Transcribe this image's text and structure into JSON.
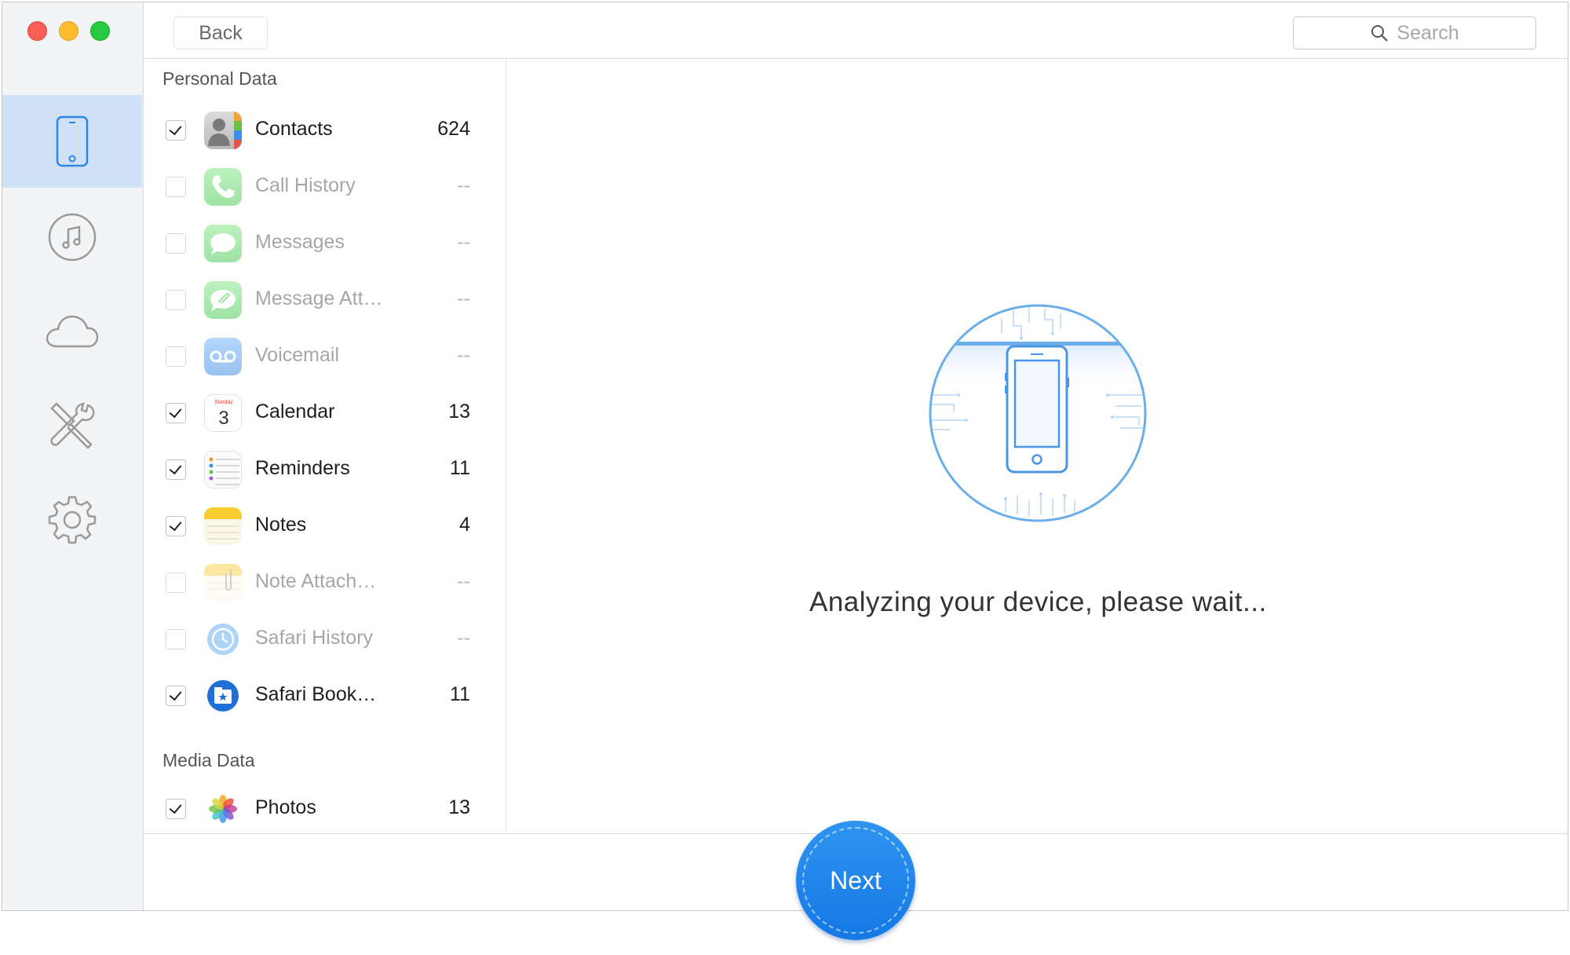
{
  "window": {
    "traffic_lights": [
      "close",
      "minimize",
      "maximize"
    ]
  },
  "rail": {
    "items": [
      {
        "icon": "phone-icon",
        "active": true
      },
      {
        "icon": "music-icon",
        "active": false
      },
      {
        "icon": "cloud-icon",
        "active": false
      },
      {
        "icon": "tools-icon",
        "active": false
      },
      {
        "icon": "gear-icon",
        "active": false
      }
    ]
  },
  "toolbar": {
    "back_label": "Back",
    "search_placeholder": "Search"
  },
  "personal": {
    "title": "Personal Data",
    "items": [
      {
        "label": "Contacts",
        "count": "624",
        "checked": true,
        "enabled": true,
        "icon": "contacts-icon"
      },
      {
        "label": "Call History",
        "count": "--",
        "checked": false,
        "enabled": false,
        "icon": "phone-call-icon"
      },
      {
        "label": "Messages",
        "count": "--",
        "checked": false,
        "enabled": false,
        "icon": "messages-icon"
      },
      {
        "label": "Message Att…",
        "count": "--",
        "checked": false,
        "enabled": false,
        "icon": "message-attachment-icon"
      },
      {
        "label": "Voicemail",
        "count": "--",
        "checked": false,
        "enabled": false,
        "icon": "voicemail-icon"
      },
      {
        "label": "Calendar",
        "count": "13",
        "checked": true,
        "enabled": true,
        "icon": "calendar-icon"
      },
      {
        "label": "Reminders",
        "count": "11",
        "checked": true,
        "enabled": true,
        "icon": "reminders-icon"
      },
      {
        "label": "Notes",
        "count": "4",
        "checked": true,
        "enabled": true,
        "icon": "notes-icon"
      },
      {
        "label": "Note Attach…",
        "count": "--",
        "checked": false,
        "enabled": false,
        "icon": "note-attachment-icon"
      },
      {
        "label": "Safari History",
        "count": "--",
        "checked": false,
        "enabled": false,
        "icon": "safari-history-icon"
      },
      {
        "label": "Safari Book…",
        "count": "11",
        "checked": true,
        "enabled": true,
        "icon": "safari-bookmarks-icon"
      }
    ]
  },
  "calendar_icon": {
    "day": "Sunday",
    "date": "3"
  },
  "media": {
    "title": "Media Data",
    "items": [
      {
        "label": "Photos",
        "count": "13",
        "checked": true,
        "enabled": true,
        "icon": "photos-icon"
      }
    ]
  },
  "main": {
    "status": "Analyzing your device, please wait..."
  },
  "footer": {
    "next_label": "Next"
  },
  "colors": {
    "accent": "#1a80e8",
    "rail_active": "#cfe1f7",
    "illustration_stroke": "#6aaeea"
  }
}
